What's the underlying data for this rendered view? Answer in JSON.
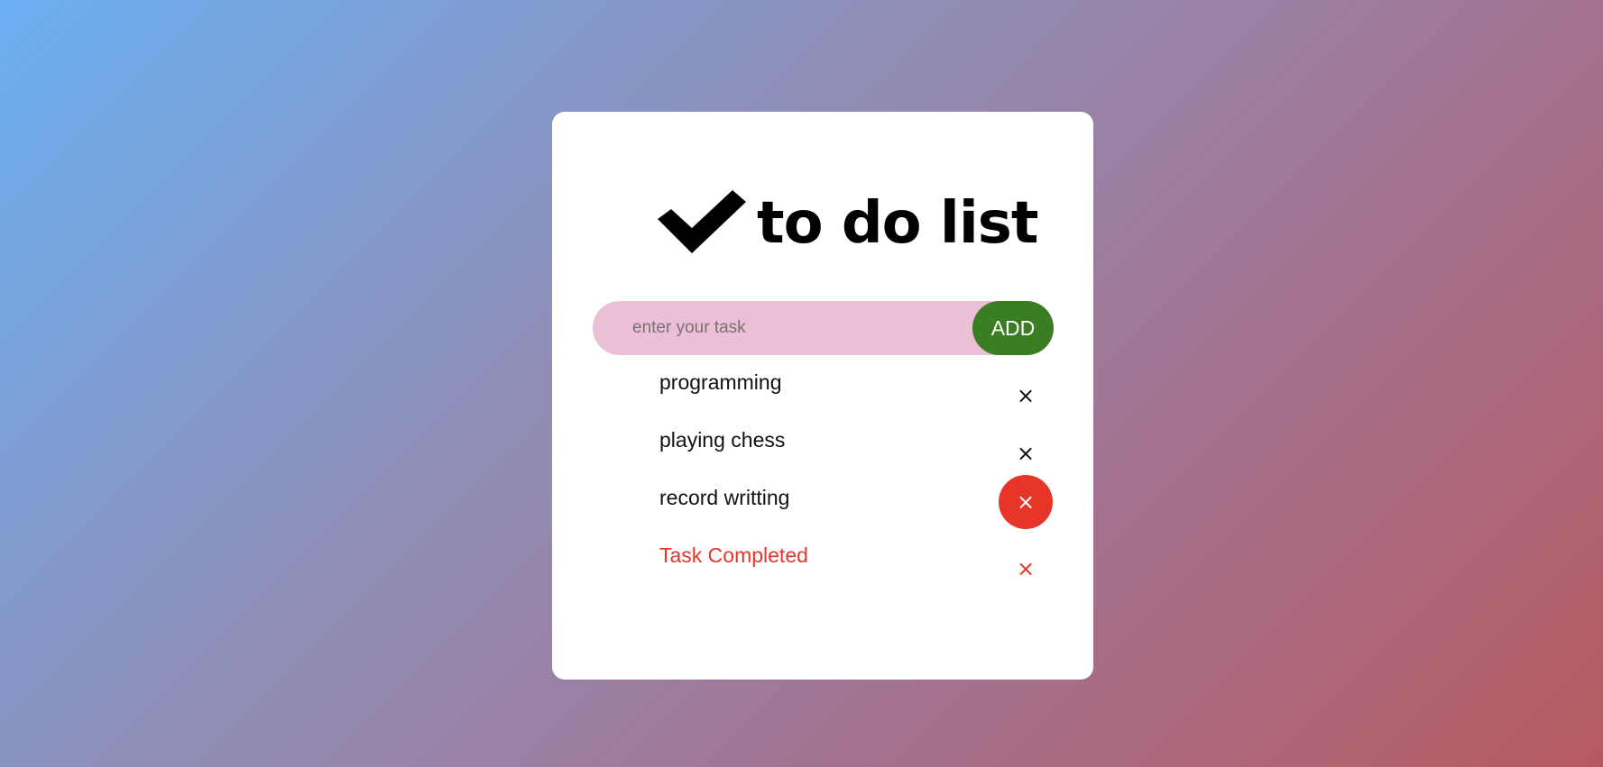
{
  "app": {
    "title": "to do list"
  },
  "input": {
    "placeholder": "enter your task",
    "value": ""
  },
  "add_button": {
    "label": "ADD"
  },
  "tasks": [
    {
      "label": "programming",
      "completed": false,
      "delete_label": "×"
    },
    {
      "label": "playing chess",
      "completed": false,
      "delete_label": "×"
    },
    {
      "label": "record writting",
      "completed": false,
      "delete_label": "×",
      "delete_hovered": true
    },
    {
      "label": "Task Completed",
      "completed": true,
      "delete_label": "×"
    }
  ],
  "icons": {
    "logo": "checkmark-icon",
    "delete": "close-icon"
  },
  "colors": {
    "background_start": "#6aaff2",
    "background_end": "#b65a60",
    "card": "#ffffff",
    "input_bg": "#ebbfd5",
    "add_button": "#3b7d23",
    "completed_text": "#e8352a",
    "delete_hover": "#e8352a"
  }
}
